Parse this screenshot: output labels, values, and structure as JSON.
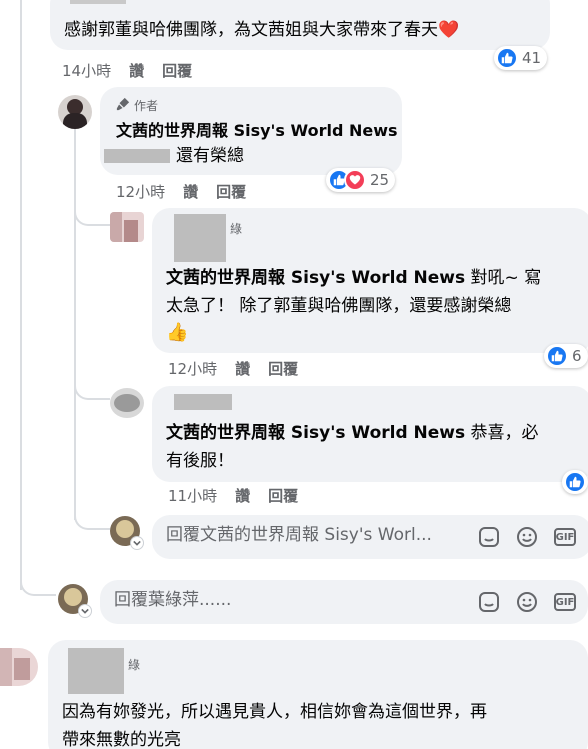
{
  "comment1": {
    "text": "感謝郭董與哈佛團隊，為文茜姐與大家帶來了春天",
    "heart": "❤️",
    "time": "14小時",
    "like_label": "讚",
    "reply_label": "回覆",
    "reaction_count": "41"
  },
  "reply1": {
    "author_tag": "作者",
    "author": "文茜的世界周報 Sisy's World News",
    "text": "還有榮總",
    "time": "12小時",
    "like_label": "讚",
    "reply_label": "回覆",
    "reaction_count": "25"
  },
  "reply2": {
    "name_suffix": "綠",
    "mention": "文茜的世界周報 Sisy's World News",
    "text_after_mention": " 對吼~ 寫",
    "text_line2": "太急了！ 除了郭董與哈佛團隊，還要感謝榮總",
    "emoji": "👍",
    "time": "12小時",
    "like_label": "讚",
    "reply_label": "回覆",
    "reaction_count": "6"
  },
  "reply3": {
    "mention": "文茜的世界周報 Sisy's World News",
    "text_after_mention": " 恭喜，必",
    "text_line2": "有後服！",
    "time": "11小時",
    "like_label": "讚",
    "reply_label": "回覆"
  },
  "reply_input_1": {
    "placeholder": "回覆文茜的世界周報 Sisy's Worl..."
  },
  "reply_input_2": {
    "placeholder": "回覆葉綠萍......"
  },
  "comment2": {
    "name_suffix": "綠",
    "text_line1": "因為有妳發光，所以遇見貴人，相信妳會為這個世界，再",
    "text_line2": "帶來無數的光亮"
  },
  "colors": {
    "bubble": "#f0f2f5",
    "meta": "#65676b",
    "like": "#1877f2",
    "love": "#f33e58"
  },
  "icons": [
    "like-icon",
    "love-icon",
    "heart-icon",
    "microphone-icon",
    "sticker-icon",
    "emoji-icon",
    "gif-icon",
    "chevron-down-icon",
    "thumbs-up-emoji"
  ]
}
